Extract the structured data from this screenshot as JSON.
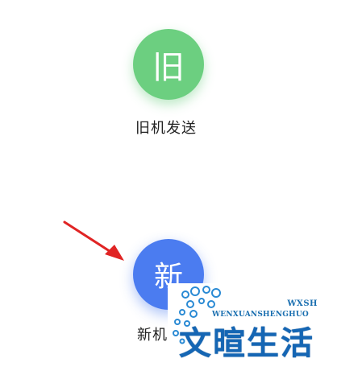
{
  "old_device": {
    "button_text": "旧",
    "label": "旧机发送",
    "color": "#6ccf80"
  },
  "new_device": {
    "button_text": "新",
    "label": "新机",
    "color": "#4b7cf0"
  },
  "annotation": {
    "arrow_color": "#e02424"
  },
  "watermark": {
    "badge": "WXSH",
    "subtitle": "WENXUANSHENGHUO",
    "title": "文暄生活",
    "color": "#1566b4"
  }
}
